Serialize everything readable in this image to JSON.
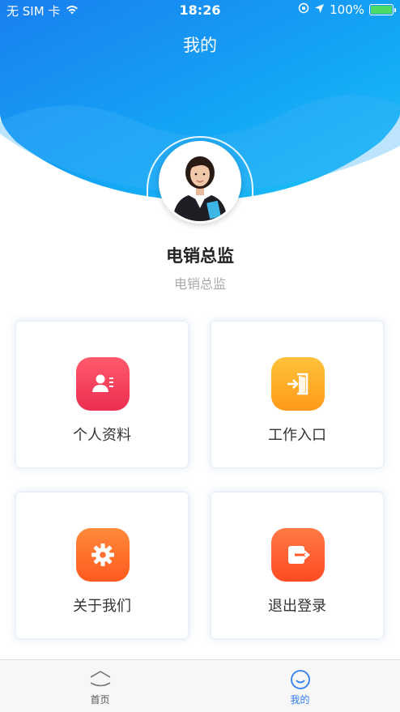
{
  "status_bar": {
    "carrier": "无 SIM 卡",
    "time": "18:26",
    "battery": "100%"
  },
  "header": {
    "title": "我的"
  },
  "user": {
    "name": "电销总监",
    "role": "电销总监"
  },
  "menu": [
    {
      "label": "个人资料",
      "icon": "profile-card-icon",
      "color_top": "#ff5a6b",
      "color_bottom": "#ec2e52"
    },
    {
      "label": "工作入口",
      "icon": "door-enter-icon",
      "color_top": "#ffc23a",
      "color_bottom": "#ff9a1a"
    },
    {
      "label": "关于我们",
      "icon": "gear-icon",
      "color_top": "#ff8a3a",
      "color_bottom": "#ff5a1e"
    },
    {
      "label": "退出登录",
      "icon": "logout-icon",
      "color_top": "#ff7a45",
      "color_bottom": "#ff4a23"
    }
  ],
  "tabbar": {
    "tabs": [
      {
        "label": "首页",
        "icon": "home-icon",
        "active": false
      },
      {
        "label": "我的",
        "icon": "smile-face-icon",
        "active": true
      }
    ]
  },
  "colors": {
    "brand_blue": "#1c8cf0",
    "active_tab": "#2f7df0",
    "inactive_tab": "#666666"
  }
}
